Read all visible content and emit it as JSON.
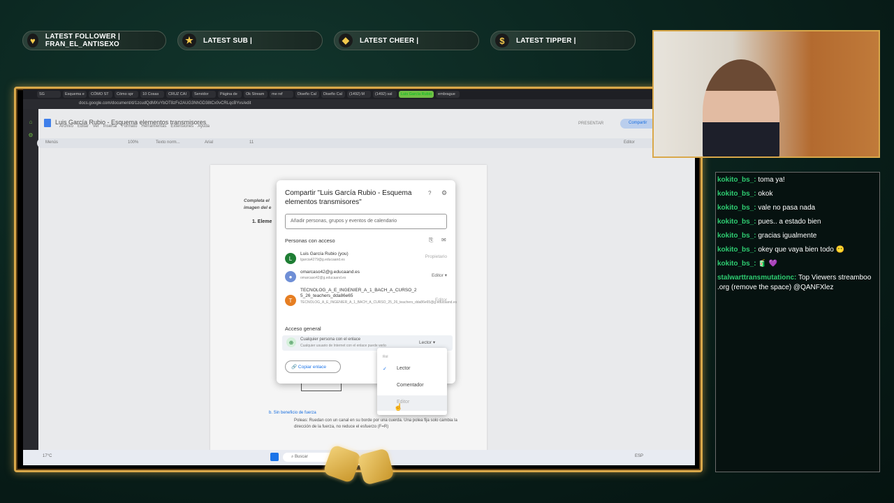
{
  "alerts": [
    {
      "icon": "heart-icon",
      "glyph": "♥",
      "label": "LATEST FOLLOWER | FRAN_EL_ANTISEXO"
    },
    {
      "icon": "star-icon",
      "glyph": "★",
      "label": "LATEST SUB |"
    },
    {
      "icon": "diamond-icon",
      "glyph": "◆",
      "label": "LATEST CHEER |"
    },
    {
      "icon": "dollar-icon",
      "glyph": "$",
      "label": "LATEST TIPPER |"
    }
  ],
  "browser": {
    "tabs": [
      "SG",
      "Esquema e",
      "CÓMO ST",
      "Cómo spr",
      "10 Cosas",
      "CRUZ CAI",
      "Servidor",
      "Página de",
      "Ok Stream",
      "me ref",
      "Diseño Cal",
      "Diseño Cal",
      "(1492) M",
      "(1492) sal",
      "Luis García Rubio",
      "embrague"
    ],
    "active_tab_index": 14,
    "url": "docs.google.com/document/d/1zcudQdMXvYbOT8zFx2AUG3NhGD38tCx0vCRLqcBYvs/edit"
  },
  "docs": {
    "title": "Luis García Rubio - Esquema elementos transmisores",
    "menu": [
      "Archivo",
      "Editar",
      "Ver",
      "Insertar",
      "Formato",
      "Herramientas",
      "Extensiones",
      "Ayuda"
    ],
    "present_label": "PRESENTAR",
    "share_label": "Compartir",
    "zoom": "100%",
    "style_label": "Texto norm...",
    "font_label": "Arial",
    "font_size": "11",
    "mode_label": "Editor",
    "menu_label": "Menús",
    "page_lines": [
      "Completa el",
      "imagen del e",
      "1.   Eleme"
    ],
    "bottom_heading": "b.   Sin beneficio de fuerza",
    "bottom_text": "Poleas: Ruedan con un canal en su borde por una cuerda. Una polea fija solo cambia la dirección de la fuerza, no reduce el esfuerzo (F=R)"
  },
  "share_dialog": {
    "title": "Compartir \"Luis García Rubio - Esquema elementos transmisores\"",
    "add_placeholder": "Añadir personas, grupos y eventos de calendario",
    "people_heading": "Personas con acceso",
    "people": [
      {
        "initial": "L",
        "color": "#1e7e34",
        "name": "Luis García Rubio (you)",
        "email": "lgarcia4279@g.educaand.es",
        "role": "Propietario"
      },
      {
        "initial": "",
        "color": "#6f8fd6",
        "name": "omarcaso42@g.educaand.es",
        "email": "omarcaso42@g.educaand.es",
        "role": "Editor"
      },
      {
        "initial": "T",
        "color": "#e67e22",
        "name": "TECNOLOG_A_E_INGENIER_A_1_BACH_A_CURSO_2 5_26_teachers_dda86e65",
        "email": "TECNOLOG_A_E_INGENIER_A_1_BACH_A_CURSO_25_26_teachers_dda86e65@g.educaand.es",
        "role": "Editor"
      }
    ],
    "general_heading": "Acceso general",
    "general_access_title": "Cualquier persona con el enlace",
    "general_access_desc": "Cualquier usuario de Internet con el enlace puede verlo",
    "general_access_role": "Lector",
    "copy_link": "Copiar enlace"
  },
  "role_menu": {
    "header": "Rol",
    "options": [
      "Lector",
      "Comentador",
      "Editor"
    ],
    "selected": "Lector"
  },
  "taskbar": {
    "weather": "17°C",
    "search": "Buscar",
    "lang": "ESP"
  },
  "chat": [
    {
      "user": "kokito_bs_:",
      "text": "toma ya!"
    },
    {
      "user": "kokito_bs_:",
      "text": "okok"
    },
    {
      "user": "kokito_bs_:",
      "text": "vale no pasa nada"
    },
    {
      "user": "kokito_bs_:",
      "text": "pues.. a estado bien"
    },
    {
      "user": "kokito_bs_:",
      "text": "gracias igualmente"
    },
    {
      "user": "kokito_bs_:",
      "text": "okey que vaya bien todo 😶"
    },
    {
      "user": "kokito_bs_:",
      "text": "🧃 💜"
    },
    {
      "user": "stalwarttransmutationc:",
      "text": "Top Viewers streamboo .org (remove the space) @QANFXlez"
    }
  ]
}
